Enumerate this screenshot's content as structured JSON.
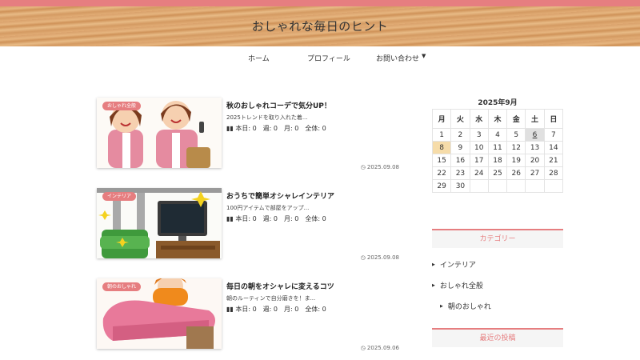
{
  "site": {
    "title": "おしゃれな毎日のヒント"
  },
  "nav": {
    "items": [
      {
        "label": "ホーム"
      },
      {
        "label": "プロフィール"
      },
      {
        "label": "お問い合わせ"
      }
    ],
    "dropdown_icon": "caret-down-icon"
  },
  "posts": [
    {
      "category": "おしゃれ全般",
      "title": "秋のおしゃれコーデで気分UP！",
      "excerpt": "2025トレンドを取り入れた着...",
      "stats": "本日: 0　週: 0　月: 0　全体: 0",
      "date": "2025.09.08"
    },
    {
      "category": "インテリア",
      "title": "おうちで簡単オシャレインテリア",
      "excerpt": "100円アイテムで部屋をアップ...",
      "stats": "本日: 0　週: 0　月: 0　全体: 0",
      "date": "2025.09.08"
    },
    {
      "category": "朝のおしゃれ",
      "title": "毎日の朝をオシャレに変えるコツ",
      "excerpt": "朝のルーティンで自分磨きを！ま...",
      "stats": "本日: 0　週: 0　月: 0　全体: 0",
      "date": "2025.09.06"
    }
  ],
  "calendar": {
    "title": "2025年9月",
    "weekdays": [
      "月",
      "火",
      "水",
      "木",
      "金",
      "土",
      "日"
    ],
    "weeks": [
      [
        "1",
        "2",
        "3",
        "4",
        "5",
        "6",
        "7"
      ],
      [
        "8",
        "9",
        "10",
        "11",
        "12",
        "13",
        "14"
      ],
      [
        "15",
        "16",
        "17",
        "18",
        "19",
        "20",
        "21"
      ],
      [
        "22",
        "23",
        "24",
        "25",
        "26",
        "27",
        "28"
      ],
      [
        "29",
        "30",
        "",
        "",
        "",
        "",
        ""
      ]
    ],
    "today": "6",
    "selected": "8"
  },
  "sidebar": {
    "categories_title": "カテゴリー",
    "categories": [
      {
        "label": "インテリア"
      },
      {
        "label": "おしゃれ全般"
      },
      {
        "label": "朝のおしゃれ"
      }
    ],
    "recent_title": "最近の投稿"
  },
  "colors": {
    "accent": "#e67e80",
    "header_wood": "#e2ad76",
    "selected_day": "#f6dca9"
  }
}
